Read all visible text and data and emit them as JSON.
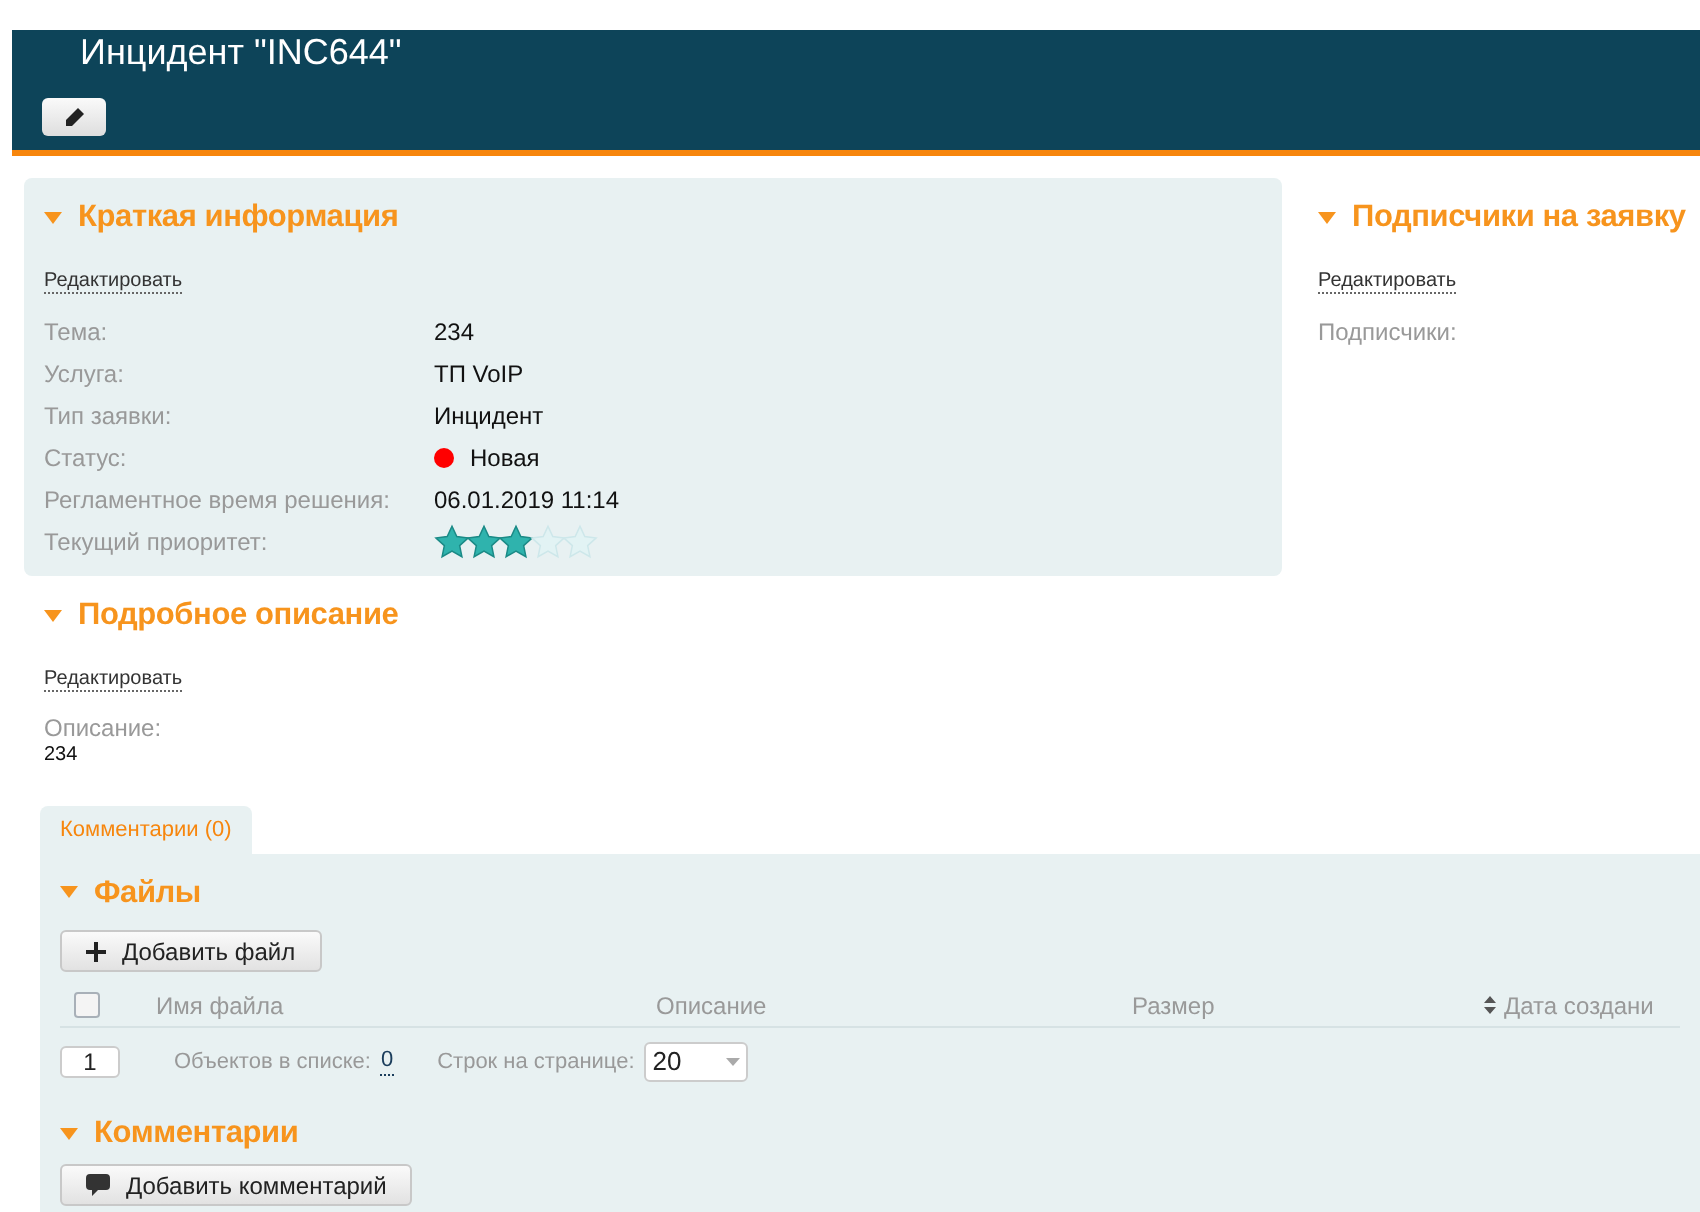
{
  "header": {
    "title": "Инцидент \"INC644\""
  },
  "summary": {
    "title": "Краткая информация",
    "expanded": true,
    "edit_link": "Редактировать",
    "fields": [
      {
        "kind": "text",
        "label": "Тема:",
        "value": "234"
      },
      {
        "kind": "text",
        "label": "Услуга:",
        "value": "ТП VoIP"
      },
      {
        "kind": "text",
        "label": "Тип заявки:",
        "value": "Инцидент"
      },
      {
        "kind": "status",
        "label": "Статус:",
        "value": "Новая",
        "color": "#ff0000"
      },
      {
        "kind": "text",
        "label": "Регламентное время решения:",
        "value": "06.01.2019 11:14"
      },
      {
        "kind": "rating",
        "label": "Текущий приоритет:",
        "stars": 3
      }
    ]
  },
  "subscribers": {
    "title": "Подписчики на заявку",
    "expanded": true,
    "edit_link": "Редактировать",
    "label": "Подписчики:"
  },
  "description": {
    "title": "Подробное описание",
    "expanded": true,
    "edit_link": "Редактировать",
    "label": "Описание:",
    "value": "234"
  },
  "tabs": [
    {
      "label": "Комментарии (0)",
      "selected": true
    }
  ],
  "files": {
    "title": "Файлы",
    "expanded": true,
    "add_button": "Добавить файл",
    "select_all_checked": false,
    "columns": [
      {
        "label": "Имя файла",
        "sortable": false
      },
      {
        "label": "Описание",
        "sortable": false
      },
      {
        "label": "Размер",
        "sortable": false
      },
      {
        "label": "Дата создани",
        "sortable": true
      }
    ],
    "pager": {
      "page": "1",
      "count_label": "Объектов в списке:",
      "count": "0",
      "rows_label": "Строк на странице:",
      "rows_per_page": "20"
    }
  },
  "comments": {
    "title": "Комментарии",
    "expanded": true,
    "add_button": "Добавить комментарий"
  }
}
